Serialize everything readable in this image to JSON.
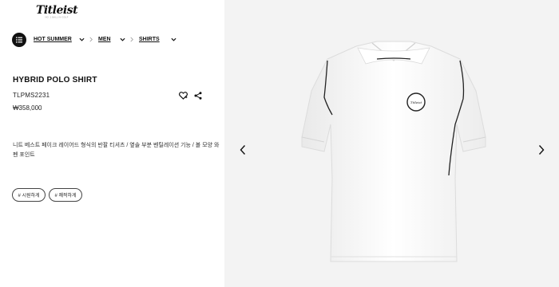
{
  "brand": {
    "logo_text": "Titleist",
    "tagline": "NO. 1 BALL IN GOLF"
  },
  "breadcrumb": [
    {
      "label": "HOT SUMMER"
    },
    {
      "label": "MEN"
    },
    {
      "label": "SHIRTS"
    }
  ],
  "product": {
    "name": "HYBRID POLO SHIRT",
    "code": "TLPMS2231",
    "price": "₩358,000",
    "description": "니트 베스트 페이크 레이어드 형식의 반팔 티셔츠 / 옆솔 부분 벤틸레이션 기능 / 볼 모양 와펜 포인트",
    "tags": [
      "# 시원하게",
      "# 쾌적하게"
    ],
    "patch_text": "Titleist"
  },
  "icons": {
    "menu": "list-icon",
    "wishlist": "heart-icon",
    "share": "share-icon",
    "prev": "chevron-left-icon",
    "next": "chevron-right-icon"
  },
  "colors": {
    "text": "#111111",
    "image_bg": "#f3f3f3"
  }
}
